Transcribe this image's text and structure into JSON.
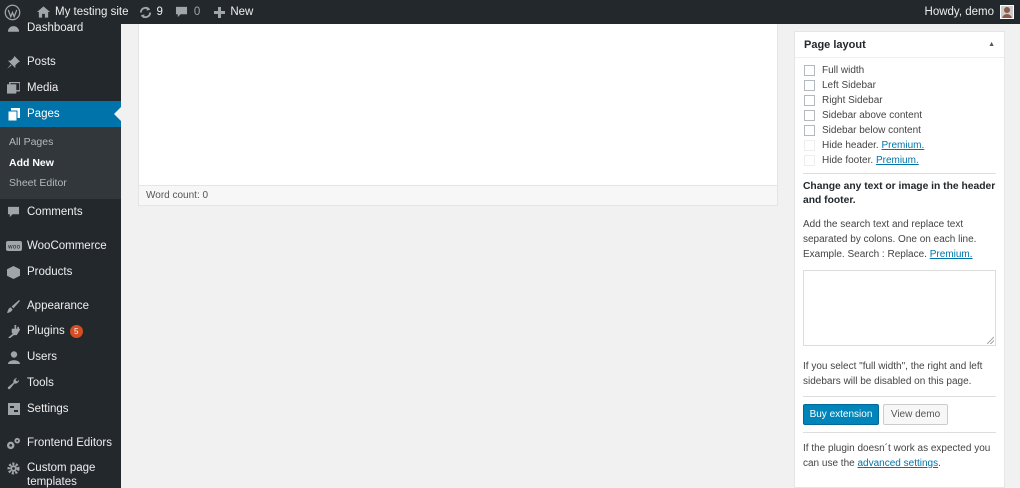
{
  "adminbar": {
    "site_name": "My testing site",
    "updates_count": "9",
    "comments_count": "0",
    "new_label": "New",
    "greeting": "Howdy, demo"
  },
  "sidebar": {
    "dashboard": "Dashboard",
    "posts": "Posts",
    "media": "Media",
    "pages": "Pages",
    "submenu": {
      "all_pages": "All Pages",
      "add_new": "Add New",
      "sheet_editor": "Sheet Editor"
    },
    "comments": "Comments",
    "woocommerce": "WooCommerce",
    "products": "Products",
    "appearance": "Appearance",
    "plugins": "Plugins",
    "plugins_badge": "5",
    "users": "Users",
    "tools": "Tools",
    "settings": "Settings",
    "frontend_editors": "Frontend Editors",
    "custom_page_templates_line1": "Custom page",
    "custom_page_templates_line2": "templates"
  },
  "editor": {
    "word_count": "Word count: 0"
  },
  "layout_box": {
    "title": "Page layout",
    "options": {
      "full_width": "Full width",
      "left_sidebar": "Left Sidebar",
      "right_sidebar": "Right Sidebar",
      "sidebar_above": "Sidebar above content",
      "sidebar_below": "Sidebar below content",
      "hide_header": "Hide header.",
      "hide_footer": "Hide footer.",
      "premium": "Premium."
    },
    "change_heading": "Change any text or image in the header and footer.",
    "search_replace_text": "Add the search text and replace text separated by colons. One on each line. Example. Search : Replace.",
    "premium": "Premium.",
    "full_width_note": "If you select \"full width\", the right and left sidebars will be disabled on this page.",
    "buy_button": "Buy extension",
    "demo_button": "View demo",
    "plugin_help_text": "If the plugin doesn´t work as expected you can use the",
    "advanced_settings": "advanced settings",
    "period": "."
  },
  "colors": {
    "admin_dark": "#23282d",
    "accent": "#0073aa",
    "badge": "#d54e21"
  }
}
